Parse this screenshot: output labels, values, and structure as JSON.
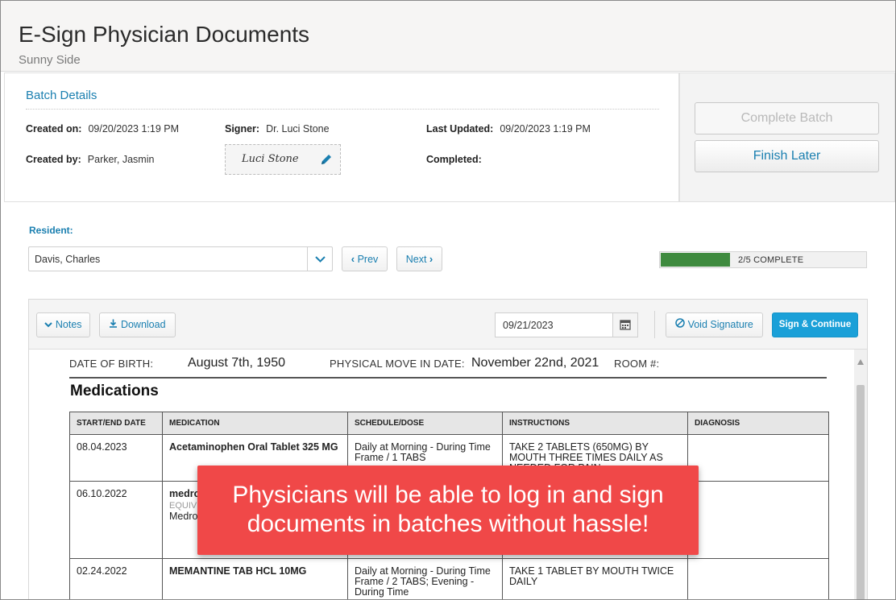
{
  "header": {
    "title": "E-Sign Physician Documents",
    "subtitle": "Sunny Side"
  },
  "batch": {
    "title": "Batch Details",
    "created_on_label": "Created on:",
    "created_on": "09/20/2023 1:19 PM",
    "created_by_label": "Created by:",
    "created_by": "Parker, Jasmin",
    "signer_label": "Signer:",
    "signer": "Dr. Luci Stone",
    "signature_text": "Luci Stone",
    "last_updated_label": "Last Updated:",
    "last_updated": "09/20/2023 1:19 PM",
    "completed_label": "Completed:",
    "completed": ""
  },
  "actions": {
    "complete_batch": "Complete Batch",
    "finish_later": "Finish Later"
  },
  "resident": {
    "label": "Resident:",
    "selected": "Davis, Charles",
    "prev": "Prev",
    "next": "Next"
  },
  "progress": {
    "text": "2/5 COMPLETE",
    "completed": 2,
    "total": 5,
    "fill_color": "#3f8b3f"
  },
  "toolbar": {
    "notes": "Notes",
    "download": "Download",
    "date": "09/21/2023",
    "void": "Void Signature",
    "sign": "Sign & Continue"
  },
  "document": {
    "dob_label": "DATE OF BIRTH:",
    "dob": "August 7th, 1950",
    "move_in_label": "PHYSICAL MOVE IN DATE:",
    "move_in": "November 22nd, 2021",
    "room_label": "ROOM #:",
    "section_title": "Medications",
    "columns": [
      "START/END DATE",
      "MEDICATION",
      "SCHEDULE/DOSE",
      "INSTRUCTIONS",
      "DIAGNOSIS"
    ],
    "rows": [
      {
        "date": "08.04.2023",
        "medication": "Acetaminophen Oral Tablet 325 MG",
        "equiv": "",
        "med_sub": "",
        "schedule": "Daily at Morning - During Time Frame / 1 TABS",
        "instructions": "TAKE 2 TABLETS (650MG) BY MOUTH THREE TIMES DAILY AS NEEDED FOR PAIN",
        "diagnosis": ""
      },
      {
        "date": "06.10.2022",
        "medication": "medroxyPROGESTERone Acetate",
        "equiv": "EQUIV",
        "med_sub": "Medroxyprogesterone 10 MG",
        "schedule": "",
        "instructions": "",
        "diagnosis": ""
      },
      {
        "date": "02.24.2022",
        "medication": "MEMANTINE TAB HCL 10MG",
        "equiv": "",
        "med_sub": "",
        "schedule": "Daily at Morning - During Time Frame / 2 TABS; Evening - During Time",
        "instructions": "TAKE 1 TABLET BY MOUTH TWICE DAILY",
        "diagnosis": ""
      }
    ]
  },
  "callout": {
    "text": "Physicians will be able to log in and sign documents in batches without hassle!",
    "color": "#f04848"
  }
}
